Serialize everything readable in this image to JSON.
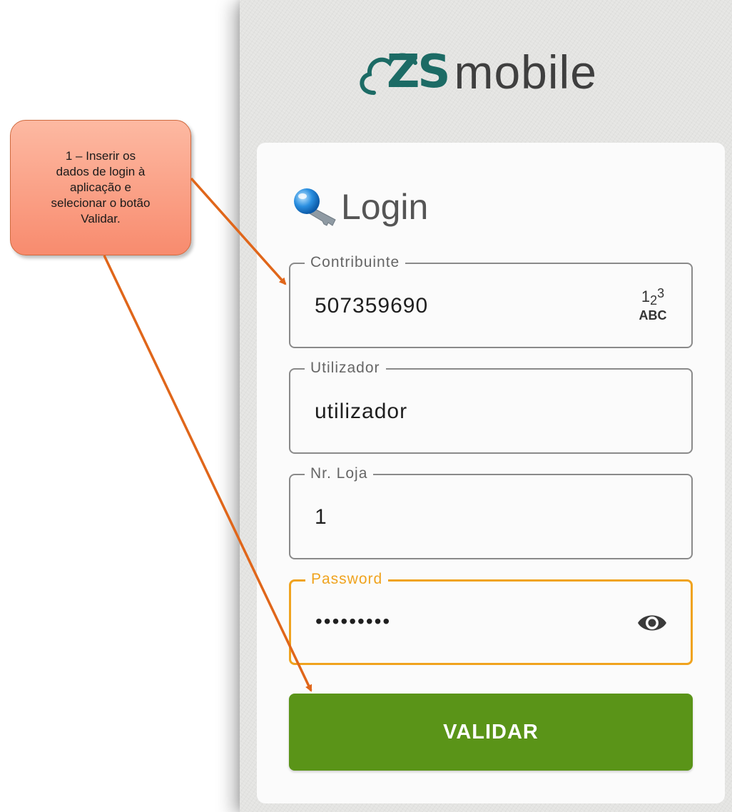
{
  "app": {
    "logo_mark": "ZS",
    "logo_text": "mobile"
  },
  "login": {
    "title": "Login"
  },
  "fields": [
    {
      "label": "Contribuinte",
      "value": "507359690",
      "icon": "keyboard-numeric-icon"
    },
    {
      "label": "Utilizador",
      "value": "utilizador"
    },
    {
      "label": "Nr. Loja",
      "value": "1"
    },
    {
      "label": "Password",
      "value": "•••••••••",
      "icon": "eye-icon",
      "focused": true
    }
  ],
  "keyboard_icon": {
    "top": "1",
    "sub": "2",
    "sup": "3",
    "bottom": "ABC"
  },
  "buttons": {
    "validate": "VALIDAR"
  },
  "annotation": {
    "text": "1 – Inserir os\ndados de login à\naplicação e\nselecionar o botão\nValidar."
  },
  "colors": {
    "brand": "#1c6b65",
    "focus": "#f0a31e",
    "button": "#5a9418",
    "callout": "#f88b6e",
    "arrow": "#e0661a"
  }
}
